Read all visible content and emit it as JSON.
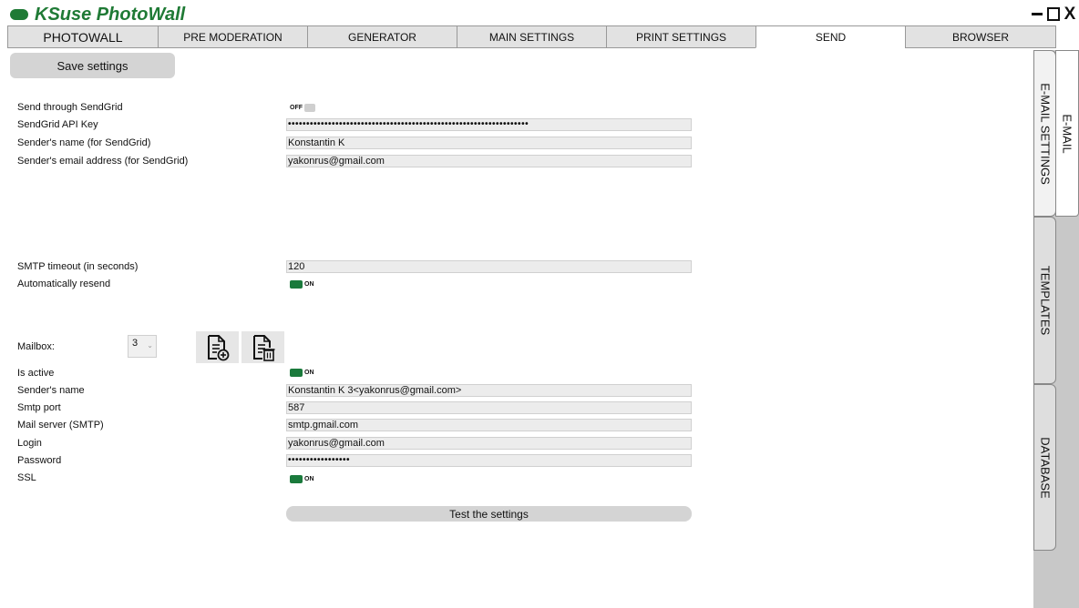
{
  "app": {
    "title": "KSuse PhotoWall"
  },
  "window_controls": {
    "close_glyph": "X"
  },
  "tabs": [
    {
      "label": "PHOTOWALL",
      "active": false
    },
    {
      "label": "PRE MODERATION",
      "active": false
    },
    {
      "label": "GENERATOR",
      "active": false
    },
    {
      "label": "MAIN SETTINGS",
      "active": false
    },
    {
      "label": "PRINT SETTINGS",
      "active": false
    },
    {
      "label": "SEND",
      "active": true
    },
    {
      "label": "BROWSER",
      "active": false
    }
  ],
  "side_tabs": {
    "email": "E-MAIL",
    "email_settings": "E-MAIL SETTINGS",
    "templates": "TEMPLATES",
    "database": "DATABASE"
  },
  "buttons": {
    "save": "Save settings",
    "test": "Test the settings"
  },
  "sendgrid": {
    "send_through_label": "Send through SendGrid",
    "send_through_state": "OFF",
    "api_key_label": "SendGrid API Key",
    "api_key_value": "••••••••••••••••••••••••••••••••••••••••••••••••••••••••••••••••••",
    "sender_name_label": "Sender's name (for SendGrid)",
    "sender_name_value": "Konstantin K",
    "sender_email_label": "Sender's email address (for SendGrid)",
    "sender_email_value": "yakonrus@gmail.com"
  },
  "smtp": {
    "timeout_label": "SMTP timeout (in seconds)",
    "timeout_value": "120",
    "auto_resend_label": "Automatically resend",
    "auto_resend_state": "ON"
  },
  "mailbox": {
    "label": "Mailbox:",
    "selected": "3",
    "add_icon": "add-document-icon",
    "delete_icon": "delete-document-icon",
    "is_active_label": "Is active",
    "is_active_state": "ON",
    "sender_name_label": "Sender's name",
    "sender_name_value": "Konstantin K 3<yakonrus@gmail.com>",
    "port_label": "Smtp port",
    "port_value": "587",
    "server_label": "Mail server (SMTP)",
    "server_value": "smtp.gmail.com",
    "login_label": "Login",
    "login_value": "yakonrus@gmail.com",
    "password_label": "Password",
    "password_value": "•••••••••••••••••",
    "ssl_label": "SSL",
    "ssl_state": "ON"
  },
  "colors": {
    "brand": "#1f7a35",
    "toggle_on": "#1a7a3c",
    "toggle_off": "#cfcfcf"
  }
}
